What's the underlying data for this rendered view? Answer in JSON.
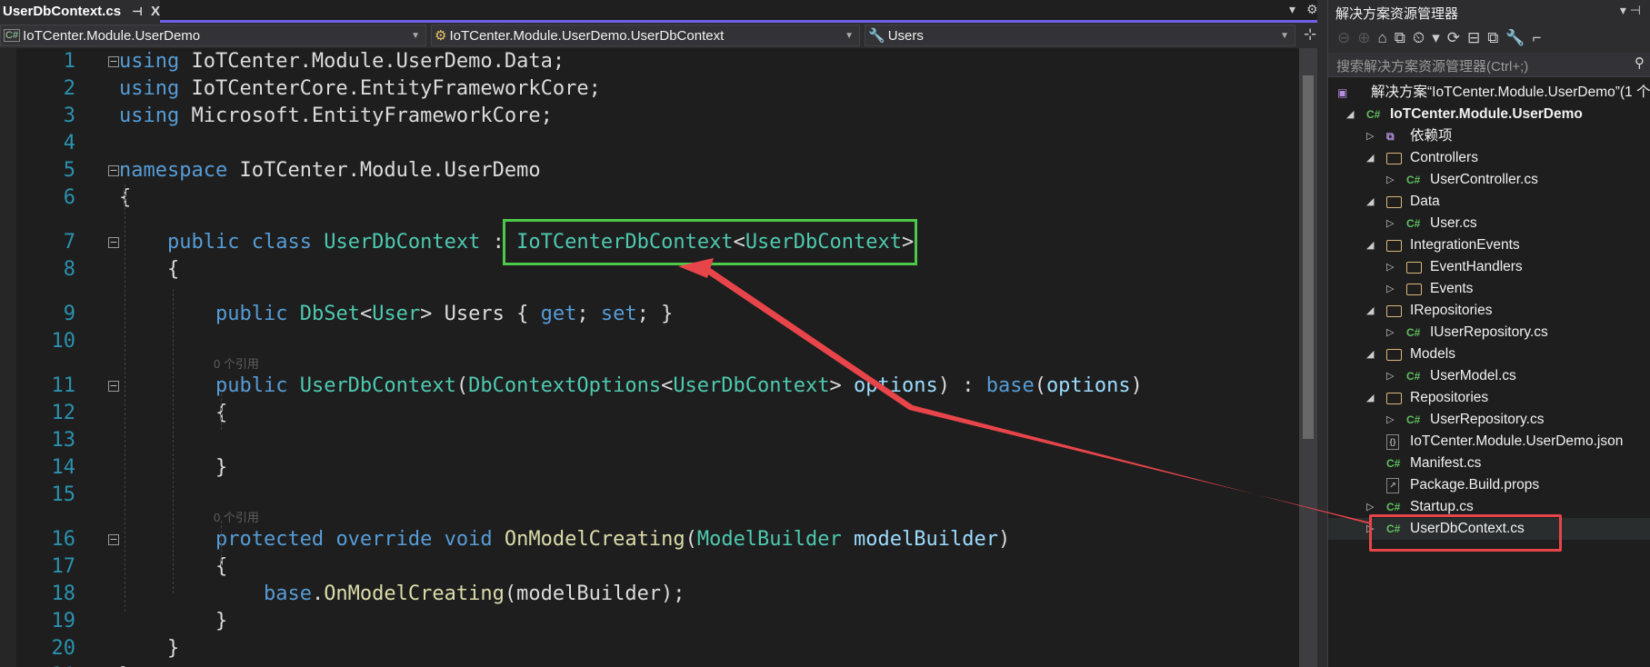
{
  "tab": {
    "title": "UserDbContext.cs",
    "pin": "⊣",
    "close": "X"
  },
  "tab_tools": {
    "dropdown": "▾",
    "settings": "⚙"
  },
  "navbar": {
    "project": "IoTCenter.Module.UserDemo",
    "type": "IoTCenter.Module.UserDemo.UserDbContext",
    "member": "Users",
    "split": "⊹"
  },
  "editor": {
    "lines": [
      {
        "n": "1",
        "fold": "⊟",
        "tokens": [
          [
            "using",
            "kw"
          ],
          [
            " IoTCenter.Module.UserDemo.Data;",
            "tx"
          ]
        ]
      },
      {
        "n": "2",
        "tokens": [
          [
            "using",
            "kw"
          ],
          [
            " IoTCenterCore.EntityFrameworkCore;",
            "tx"
          ]
        ]
      },
      {
        "n": "3",
        "tokens": [
          [
            "using",
            "kw"
          ],
          [
            " Microsoft.EntityFrameworkCore;",
            "tx"
          ]
        ]
      },
      {
        "n": "4",
        "tokens": []
      },
      {
        "n": "5",
        "fold": "⊟",
        "tokens": [
          [
            "namespace",
            "kw"
          ],
          [
            " IoTCenter.Module.UserDemo",
            "tx"
          ]
        ]
      },
      {
        "n": "6",
        "tokens": [
          [
            "{",
            "tx"
          ]
        ]
      },
      {
        "n": "7",
        "fold": "⊟",
        "lens": "",
        "tokens": [
          [
            "    ",
            "tx"
          ],
          [
            "public",
            "kw"
          ],
          [
            " ",
            "tx"
          ],
          [
            "class",
            "kw"
          ],
          [
            " ",
            "tx"
          ],
          [
            "UserDbContext",
            "ty"
          ],
          [
            " : ",
            "tx"
          ],
          [
            "IoTCenterDbContext",
            "ty"
          ],
          [
            "<",
            "tx"
          ],
          [
            "UserDbContext",
            "ty"
          ],
          [
            ">",
            "tx"
          ]
        ]
      },
      {
        "n": "8",
        "tokens": [
          [
            "    {",
            "tx"
          ]
        ]
      },
      {
        "n": "9",
        "lens": "",
        "tokens": [
          [
            "        ",
            "tx"
          ],
          [
            "public",
            "kw"
          ],
          [
            " ",
            "tx"
          ],
          [
            "DbSet",
            "ty"
          ],
          [
            "<",
            "tx"
          ],
          [
            "User",
            "ty"
          ],
          [
            "> Users { ",
            "tx"
          ],
          [
            "get",
            "kw"
          ],
          [
            "; ",
            "tx"
          ],
          [
            "set",
            "kw"
          ],
          [
            "; }",
            "tx"
          ]
        ]
      },
      {
        "n": "10",
        "tokens": []
      },
      {
        "n": "11",
        "fold": "⊟",
        "lens": "0 个引用",
        "tokens": [
          [
            "        ",
            "tx"
          ],
          [
            "public",
            "kw"
          ],
          [
            " ",
            "tx"
          ],
          [
            "UserDbContext",
            "ty"
          ],
          [
            "(",
            "tx"
          ],
          [
            "DbContextOptions",
            "ty"
          ],
          [
            "<",
            "tx"
          ],
          [
            "UserDbContext",
            "ty"
          ],
          [
            "> ",
            "tx"
          ],
          [
            "options",
            "pa"
          ],
          [
            ") : ",
            "tx"
          ],
          [
            "base",
            "kw"
          ],
          [
            "(",
            "tx"
          ],
          [
            "options",
            "pa"
          ],
          [
            ")",
            "tx"
          ]
        ]
      },
      {
        "n": "12",
        "tokens": [
          [
            "        {",
            "tx"
          ]
        ]
      },
      {
        "n": "13",
        "tokens": []
      },
      {
        "n": "14",
        "tokens": [
          [
            "        }",
            "tx"
          ]
        ]
      },
      {
        "n": "15",
        "tokens": []
      },
      {
        "n": "16",
        "fold": "⊟",
        "lens": "0 个引用",
        "tokens": [
          [
            "        ",
            "tx"
          ],
          [
            "protected",
            "kw"
          ],
          [
            " ",
            "tx"
          ],
          [
            "override",
            "kw"
          ],
          [
            " ",
            "tx"
          ],
          [
            "void",
            "kw"
          ],
          [
            " ",
            "tx"
          ],
          [
            "OnModelCreating",
            "me"
          ],
          [
            "(",
            "tx"
          ],
          [
            "ModelBuilder",
            "ty"
          ],
          [
            " ",
            "tx"
          ],
          [
            "modelBuilder",
            "pa"
          ],
          [
            ")",
            "tx"
          ]
        ]
      },
      {
        "n": "17",
        "tokens": [
          [
            "        {",
            "tx"
          ]
        ]
      },
      {
        "n": "18",
        "tokens": [
          [
            "            ",
            "tx"
          ],
          [
            "base",
            "kw"
          ],
          [
            ".",
            "tx"
          ],
          [
            "OnModelCreating",
            "me"
          ],
          [
            "(modelBuilder);",
            "tx"
          ]
        ]
      },
      {
        "n": "19",
        "tokens": [
          [
            "        }",
            "tx"
          ]
        ]
      },
      {
        "n": "20",
        "tokens": [
          [
            "    }",
            "tx"
          ]
        ]
      },
      {
        "n": "21",
        "tokens": [
          [
            "}",
            "tx"
          ]
        ]
      }
    ]
  },
  "solution_explorer": {
    "title": "解决方案资源管理器",
    "title_tools": "▾ ⊣",
    "toolbar": [
      "⊖",
      "⊕",
      "⌂",
      "⧉",
      "⏲",
      "▾",
      "⟳",
      "⊟",
      "⧉",
      "🔧",
      "⌐"
    ],
    "search_placeholder": "搜索解决方案资源管理器(Ctrl+;)",
    "search_icon": "⚲",
    "items": [
      {
        "label": "解决方案“IoTCenter.Module.UserDemo”(1 个",
        "level": 0,
        "exp": "",
        "icon": "solution",
        "glyph": "▣"
      },
      {
        "label": "IoTCenter.Module.UserDemo",
        "level": 1,
        "exp": "◢",
        "icon": "cs",
        "glyph": "C#",
        "bold": true
      },
      {
        "label": "依赖项",
        "level": 2,
        "exp": "▷",
        "icon": "deps",
        "glyph": "⧉"
      },
      {
        "label": "Controllers",
        "level": 2,
        "exp": "◢",
        "icon": "folder"
      },
      {
        "label": "UserController.cs",
        "level": 3,
        "exp": "▷",
        "icon": "cs",
        "glyph": "C#"
      },
      {
        "label": "Data",
        "level": 2,
        "exp": "◢",
        "icon": "folder"
      },
      {
        "label": "User.cs",
        "level": 3,
        "exp": "▷",
        "icon": "cs",
        "glyph": "C#"
      },
      {
        "label": "IntegrationEvents",
        "level": 2,
        "exp": "◢",
        "icon": "folder"
      },
      {
        "label": "EventHandlers",
        "level": 3,
        "exp": "▷",
        "icon": "folder"
      },
      {
        "label": "Events",
        "level": 3,
        "exp": "▷",
        "icon": "folder"
      },
      {
        "label": "IRepositories",
        "level": 2,
        "exp": "◢",
        "icon": "folder"
      },
      {
        "label": "IUserRepository.cs",
        "level": 3,
        "exp": "▷",
        "icon": "cs",
        "glyph": "C#"
      },
      {
        "label": "Models",
        "level": 2,
        "exp": "◢",
        "icon": "folder"
      },
      {
        "label": "UserModel.cs",
        "level": 3,
        "exp": "▷",
        "icon": "cs",
        "glyph": "C#"
      },
      {
        "label": "Repositories",
        "level": 2,
        "exp": "◢",
        "icon": "folder"
      },
      {
        "label": "UserRepository.cs",
        "level": 3,
        "exp": "▷",
        "icon": "cs",
        "glyph": "C#"
      },
      {
        "label": "IoTCenter.Module.UserDemo.json",
        "level": 2,
        "exp": "",
        "icon": "file",
        "glyph": "{}"
      },
      {
        "label": "Manifest.cs",
        "level": 2,
        "exp": "",
        "icon": "cs",
        "glyph": "C#"
      },
      {
        "label": "Package.Build.props",
        "level": 2,
        "exp": "",
        "icon": "file",
        "glyph": "↗"
      },
      {
        "label": "Startup.cs",
        "level": 2,
        "exp": "▷",
        "icon": "cs",
        "glyph": "C#"
      },
      {
        "label": "UserDbContext.cs",
        "level": 2,
        "exp": "▷",
        "icon": "cs",
        "glyph": "C#",
        "selected": true
      }
    ]
  },
  "annotations": {
    "green_box_color": "#4ec84a",
    "red_box_color": "#e8454a",
    "arrow_color": "#e8454a"
  }
}
